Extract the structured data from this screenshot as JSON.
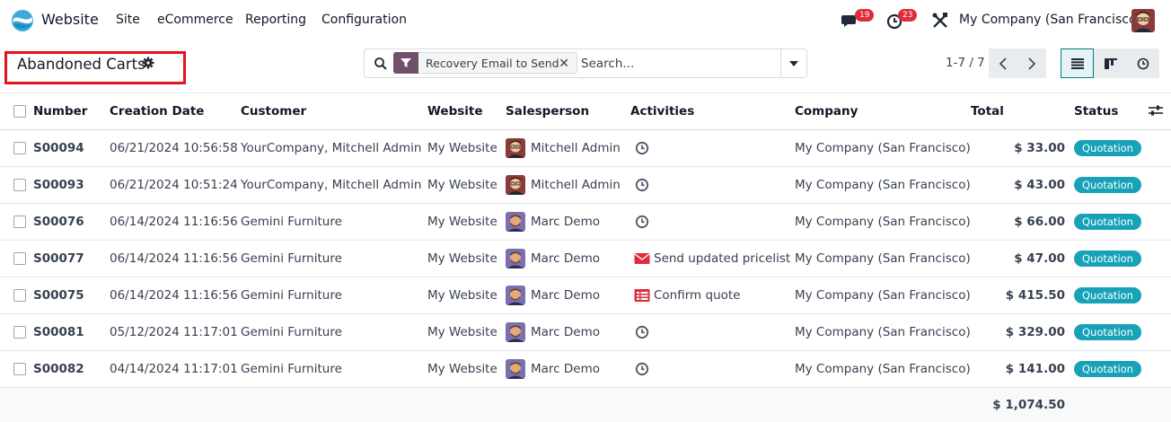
{
  "navbar": {
    "app_name": "Website",
    "menu": [
      "Site",
      "eCommerce",
      "Reporting",
      "Configuration"
    ],
    "messages_count": "19",
    "activities_count": "23",
    "company": "My Company (San Francisco)"
  },
  "control_panel": {
    "title": "Abandoned Carts",
    "facet_label": "Recovery Email to Send",
    "search_placeholder": "Search...",
    "pager": "1-7 / 7"
  },
  "table": {
    "headers": {
      "number": "Number",
      "creation_date": "Creation Date",
      "customer": "Customer",
      "website": "Website",
      "salesperson": "Salesperson",
      "activities": "Activities",
      "company": "Company",
      "total": "Total",
      "status": "Status"
    },
    "rows": [
      {
        "number": "S00094",
        "date": "06/21/2024 10:56:58",
        "customer": "YourCompany, Mitchell Admin",
        "website": "My Website",
        "salesperson": "Mitchell Admin",
        "avatar": "mitchell",
        "activity_icon": "clock-icon",
        "activity_text": "",
        "company": "My Company (San Francisco)",
        "total": "$ 33.00",
        "status": "Quotation"
      },
      {
        "number": "S00093",
        "date": "06/21/2024 10:51:24",
        "customer": "YourCompany, Mitchell Admin",
        "website": "My Website",
        "salesperson": "Mitchell Admin",
        "avatar": "mitchell",
        "activity_icon": "clock-icon",
        "activity_text": "",
        "company": "My Company (San Francisco)",
        "total": "$ 43.00",
        "status": "Quotation"
      },
      {
        "number": "S00076",
        "date": "06/14/2024 11:16:56",
        "customer": "Gemini Furniture",
        "website": "My Website",
        "salesperson": "Marc Demo",
        "avatar": "marc",
        "activity_icon": "clock-icon",
        "activity_text": "",
        "company": "My Company (San Francisco)",
        "total": "$ 66.00",
        "status": "Quotation"
      },
      {
        "number": "S00077",
        "date": "06/14/2024 11:16:56",
        "customer": "Gemini Furniture",
        "website": "My Website",
        "salesperson": "Marc Demo",
        "avatar": "marc",
        "activity_icon": "envelope-icon",
        "activity_text": "Send updated pricelist",
        "company": "My Company (San Francisco)",
        "total": "$ 47.00",
        "status": "Quotation"
      },
      {
        "number": "S00075",
        "date": "06/14/2024 11:16:56",
        "customer": "Gemini Furniture",
        "website": "My Website",
        "salesperson": "Marc Demo",
        "avatar": "marc",
        "activity_icon": "tasks-icon",
        "activity_text": "Confirm quote",
        "company": "My Company (San Francisco)",
        "total": "$ 415.50",
        "status": "Quotation"
      },
      {
        "number": "S00081",
        "date": "05/12/2024 11:17:01",
        "customer": "Gemini Furniture",
        "website": "My Website",
        "salesperson": "Marc Demo",
        "avatar": "marc",
        "activity_icon": "clock-icon",
        "activity_text": "",
        "company": "My Company (San Francisco)",
        "total": "$ 329.00",
        "status": "Quotation"
      },
      {
        "number": "S00082",
        "date": "04/14/2024 11:17:01",
        "customer": "Gemini Furniture",
        "website": "My Website",
        "salesperson": "Marc Demo",
        "avatar": "marc",
        "activity_icon": "clock-icon",
        "activity_text": "",
        "company": "My Company (San Francisco)",
        "total": "$ 141.00",
        "status": "Quotation"
      }
    ],
    "sum_total": "$ 1,074.50"
  },
  "colors": {
    "brand": "#71506b",
    "status_badge": "#17a2b8",
    "active_view": "#017e84",
    "badge_red": "#e02b3c",
    "highlight": "#e0141e"
  }
}
